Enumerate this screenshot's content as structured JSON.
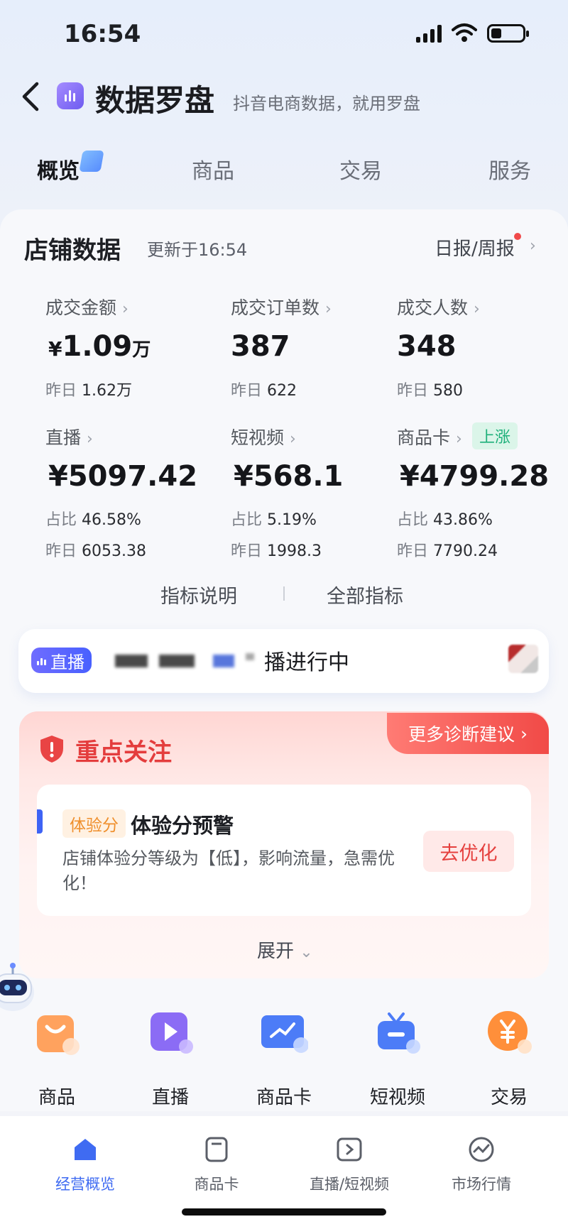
{
  "status_bar": {
    "time": "16:54"
  },
  "header": {
    "title": "数据罗盘",
    "subtitle": "抖音电商数据，就用罗盘"
  },
  "tabs": [
    {
      "label": "概览",
      "active": true
    },
    {
      "label": "商品",
      "active": false
    },
    {
      "label": "交易",
      "active": false
    },
    {
      "label": "服务",
      "active": false
    }
  ],
  "store": {
    "title": "店铺数据",
    "updated": "更新于16:54",
    "report_link": "日报/周报",
    "metrics": [
      {
        "label": "成交金额",
        "currency": "¥",
        "value": "1.09",
        "unit": "万",
        "yesterday_label": "昨日",
        "yesterday": "1.62万"
      },
      {
        "label": "成交订单数",
        "value": "387",
        "yesterday_label": "昨日",
        "yesterday": "622"
      },
      {
        "label": "成交人数",
        "value": "348",
        "yesterday_label": "昨日",
        "yesterday": "580"
      }
    ],
    "channels": [
      {
        "label": "直播",
        "value": "¥5097.42",
        "share_label": "占比",
        "share": "46.58%",
        "yesterday_label": "昨日",
        "yesterday": "6053.38"
      },
      {
        "label": "短视频",
        "value": "¥568.1",
        "share_label": "占比",
        "share": "5.19%",
        "yesterday_label": "昨日",
        "yesterday": "1998.3"
      },
      {
        "label": "商品卡",
        "badge": "上涨",
        "value": "¥4799.28",
        "share_label": "占比",
        "share": "43.86%",
        "yesterday_label": "昨日",
        "yesterday": "7790.24"
      }
    ],
    "links": {
      "explain": "指标说明",
      "all": "全部指标"
    }
  },
  "live": {
    "tag": "直播",
    "status": "播进行中"
  },
  "focus": {
    "title": "重点关注",
    "more": "更多诊断建议",
    "alert": {
      "tag": "体验分",
      "title": "体验分预警",
      "desc": "店铺体验分等级为【低】，影响流量，急需优化！",
      "action": "去优化"
    },
    "expand": "展开"
  },
  "shortcuts": [
    {
      "label": "商品",
      "icon": "shopping-bag-icon"
    },
    {
      "label": "直播",
      "icon": "play-icon"
    },
    {
      "label": "商品卡",
      "icon": "trend-card-icon"
    },
    {
      "label": "短视频",
      "icon": "tv-icon"
    },
    {
      "label": "交易",
      "icon": "yen-icon"
    }
  ],
  "bottom_nav": [
    {
      "label": "经营概览",
      "active": true
    },
    {
      "label": "商品卡",
      "active": false
    },
    {
      "label": "直播/短视频",
      "active": false
    },
    {
      "label": "市场行情",
      "active": false
    }
  ],
  "colors": {
    "accent": "#3f6bf2",
    "alert": "#e43d3d",
    "rise": "#1eb07a"
  }
}
